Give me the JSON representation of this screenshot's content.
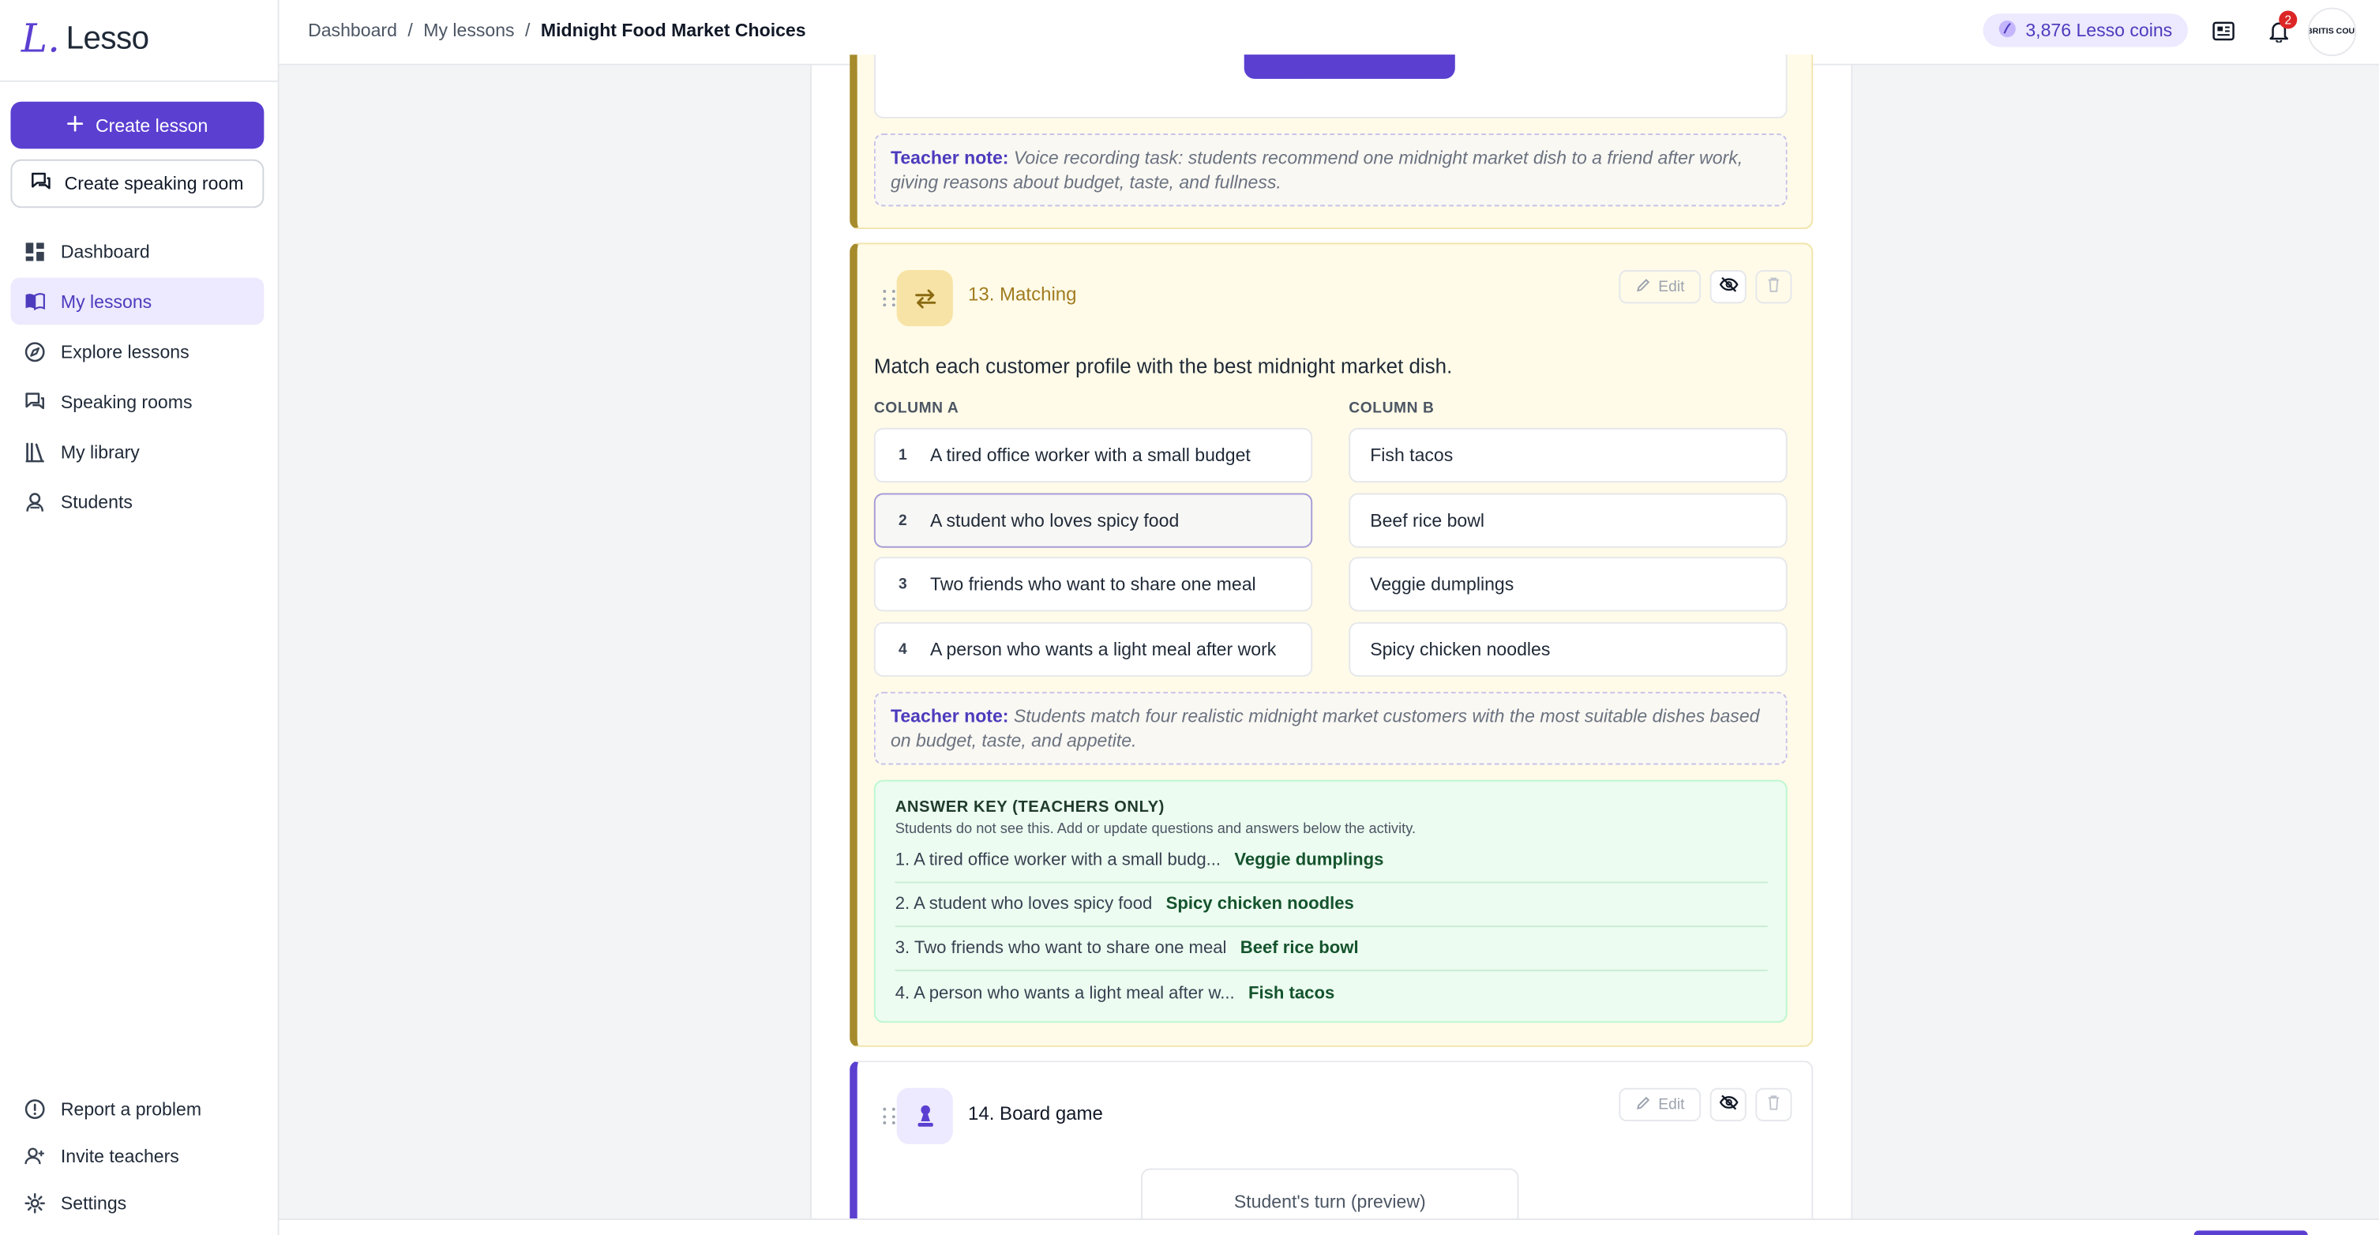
{
  "app": {
    "logo_mark": "L.",
    "logo_text": "Lesso"
  },
  "sidebar": {
    "create_lesson": "Create lesson",
    "create_speaking_room": "Create speaking room",
    "items": [
      {
        "label": "Dashboard",
        "icon": "dashboard-icon",
        "active": false
      },
      {
        "label": "My lessons",
        "icon": "book-icon",
        "active": true
      },
      {
        "label": "Explore lessons",
        "icon": "compass-icon",
        "active": false
      },
      {
        "label": "Speaking rooms",
        "icon": "chat-icon",
        "active": false
      },
      {
        "label": "My library",
        "icon": "library-icon",
        "active": false
      },
      {
        "label": "Students",
        "icon": "students-icon",
        "active": false
      }
    ],
    "bottom_items": [
      {
        "label": "Report a problem",
        "icon": "alert-icon"
      },
      {
        "label": "Invite teachers",
        "icon": "invite-icon"
      },
      {
        "label": "Settings",
        "icon": "gear-icon"
      }
    ]
  },
  "topbar": {
    "breadcrumb": [
      "Dashboard",
      "My lessons",
      "Midnight Food Market Choices"
    ],
    "separator": "/",
    "coins": "3,876 Lesso coins",
    "notification_count": "2",
    "avatar_text": "BRITIS COUNC"
  },
  "card12": {
    "note_label": "Teacher note:",
    "note_text": "Voice recording task: students recommend one midnight market dish to a friend after work, giving reasons about budget, taste, and fullness."
  },
  "card13": {
    "title": "13. Matching",
    "edit_label": "Edit",
    "prompt": "Match each customer profile with the best midnight market dish.",
    "column_a_label": "COLUMN A",
    "column_b_label": "COLUMN B",
    "column_a": [
      {
        "num": "1",
        "text": "A tired office worker with a small budget"
      },
      {
        "num": "2",
        "text": "A student who loves spicy food"
      },
      {
        "num": "3",
        "text": "Two friends who want to share one meal"
      },
      {
        "num": "4",
        "text": "A person who wants a light meal after work"
      }
    ],
    "column_b": [
      "Fish tacos",
      "Beef rice bowl",
      "Veggie dumplings",
      "Spicy chicken noodles"
    ],
    "note_label": "Teacher note:",
    "note_text": "Students match four realistic midnight market customers with the most suitable dishes based on budget, taste, and appetite.",
    "answer_key": {
      "title": "ANSWER KEY (TEACHERS ONLY)",
      "subtitle": "Students do not see this. Add or update questions and answers below the activity.",
      "rows": [
        {
          "question": "1. A tired office worker with a small budg...",
          "answer": "Veggie dumplings"
        },
        {
          "question": "2. A student who loves spicy food",
          "answer": "Spicy chicken noodles"
        },
        {
          "question": "3. Two friends who want to share one meal",
          "answer": "Beef rice bowl"
        },
        {
          "question": "4. A person who wants a light meal after w...",
          "answer": "Fish tacos"
        }
      ]
    }
  },
  "card14": {
    "title": "14. Board game",
    "edit_label": "Edit",
    "preview_label": "Student's turn (preview)"
  },
  "colors": {
    "brand": "#5b3fd1",
    "matching_accent": "#a68b2c",
    "card_bg": "#fffbe8",
    "answer_key_bg": "#ecfcf0"
  }
}
